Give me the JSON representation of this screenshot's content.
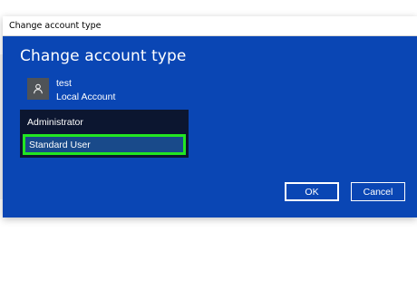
{
  "window": {
    "title": "Change account type"
  },
  "dialog": {
    "heading": "Change account type",
    "user": {
      "name": "test",
      "account_type": "Local Account",
      "avatar_icon": "person-icon"
    },
    "account_type_dropdown": {
      "options": [
        "Administrator",
        "Standard User"
      ],
      "selected": "Standard User",
      "highlight_color": "#22e622"
    },
    "buttons": {
      "ok_label": "OK",
      "cancel_label": "Cancel"
    }
  },
  "colors": {
    "dialog_background": "#0a46b4",
    "dropdown_background": "#0c1630"
  }
}
